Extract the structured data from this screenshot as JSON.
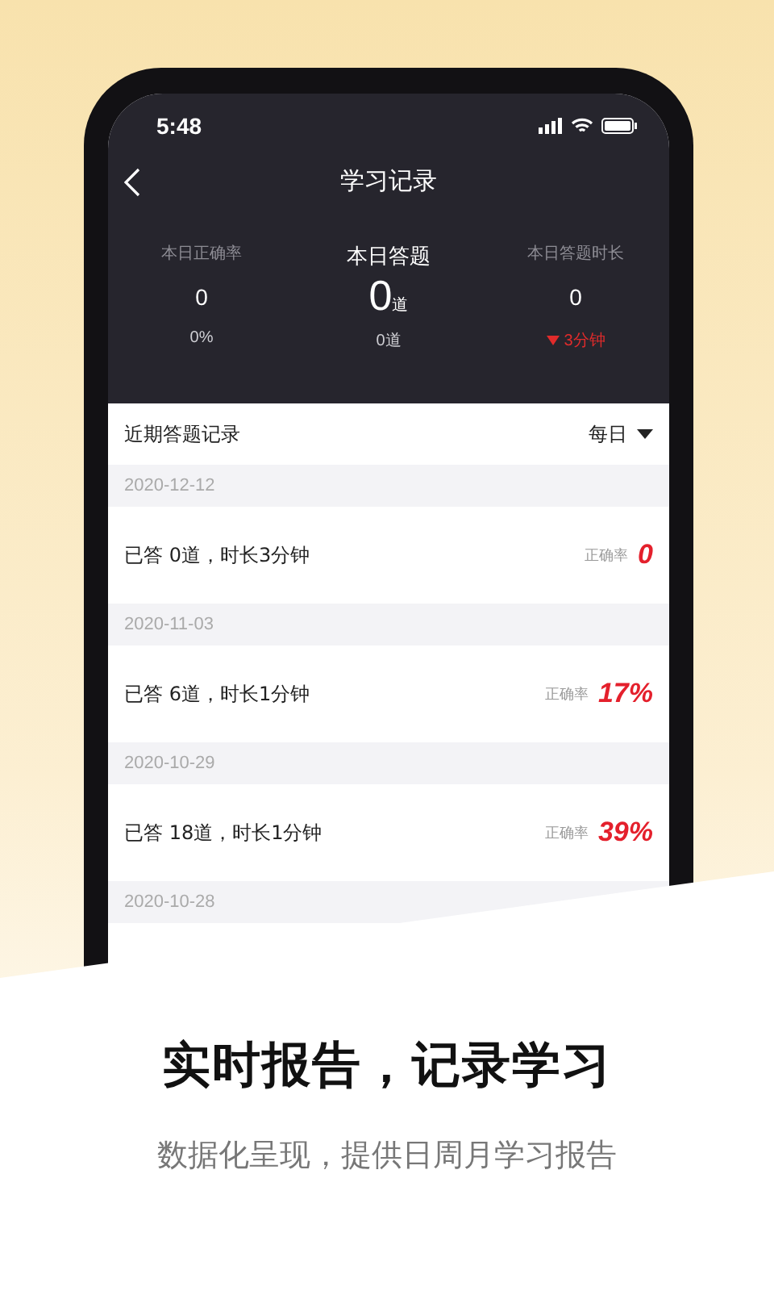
{
  "status_bar": {
    "time": "5:48"
  },
  "nav": {
    "title": "学习记录"
  },
  "stats": [
    {
      "kind": "minor",
      "label": "本日正确率",
      "value": "0",
      "sub": "0%",
      "decrease": false
    },
    {
      "kind": "main",
      "label": "本日答题",
      "value": "0",
      "unit": "道",
      "sub": "0道",
      "decrease": false
    },
    {
      "kind": "minor",
      "label": "本日答题时长",
      "value": "0",
      "sub": "3分钟",
      "decrease": true
    }
  ],
  "records": {
    "title": "近期答题记录",
    "filter": "每日",
    "days": [
      {
        "date": "2020-12-12",
        "summary": "已答 0道，时长3分钟",
        "rate_label": "正确率",
        "rate": "0"
      },
      {
        "date": "2020-11-03",
        "summary": "已答 6道，时长1分钟",
        "rate_label": "正确率",
        "rate": "17%"
      },
      {
        "date": "2020-10-29",
        "summary": "已答 18道，时长1分钟",
        "rate_label": "正确率",
        "rate": "39%"
      },
      {
        "date": "2020-10-28"
      }
    ]
  },
  "promo": {
    "headline": "实时报告，记录学习",
    "subtitle": "数据化呈现，提供日周月学习报告"
  }
}
